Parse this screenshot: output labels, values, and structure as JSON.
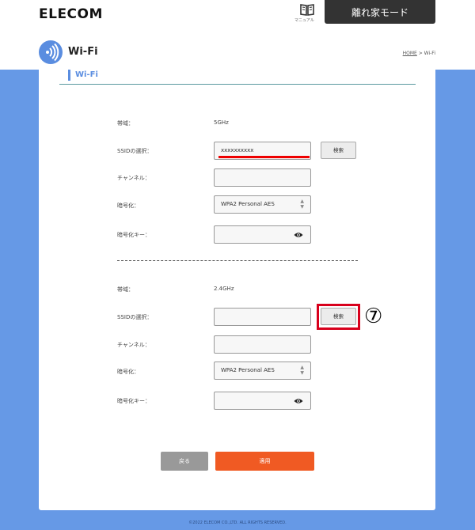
{
  "header": {
    "logo": "ELECOM",
    "manual_label": "マニュアル",
    "mode_button": "離れ家モード"
  },
  "page": {
    "title": "Wi-Fi",
    "breadcrumb_home": "HOME",
    "breadcrumb_sep": " > ",
    "breadcrumb_current": "Wi-Fi",
    "section_title": "Wi-Fi"
  },
  "band5": {
    "band_label": "帯域：",
    "band_value": "5GHz",
    "ssid_label": "SSIDの選択：",
    "ssid_value": "xxxxxxxxxx",
    "search_button": "検索",
    "channel_label": "チャンネル：",
    "channel_value": "",
    "encryption_label": "暗号化：",
    "encryption_value": "WPA2 Personal AES",
    "key_label": "暗号化キー：",
    "key_value": ""
  },
  "band24": {
    "band_label": "帯域：",
    "band_value": "2.4GHz",
    "ssid_label": "SSIDの選択：",
    "ssid_value": "",
    "search_button": "検索",
    "channel_label": "チャンネル：",
    "channel_value": "",
    "encryption_label": "暗号化：",
    "encryption_value": "WPA2 Personal AES",
    "key_label": "暗号化キー：",
    "key_value": ""
  },
  "annotation": {
    "step_marker": "⑦",
    "highlight_color": "#d8001c"
  },
  "actions": {
    "back": "戻る",
    "apply": "適用"
  },
  "footer": {
    "copyright": "©2022 ELECOM CO.,LTD. ALL RIGHTS RESERVED."
  },
  "colors": {
    "background_blue": "#6699e6",
    "accent_blue": "#5a8de0",
    "apply_orange": "#f05a23"
  }
}
